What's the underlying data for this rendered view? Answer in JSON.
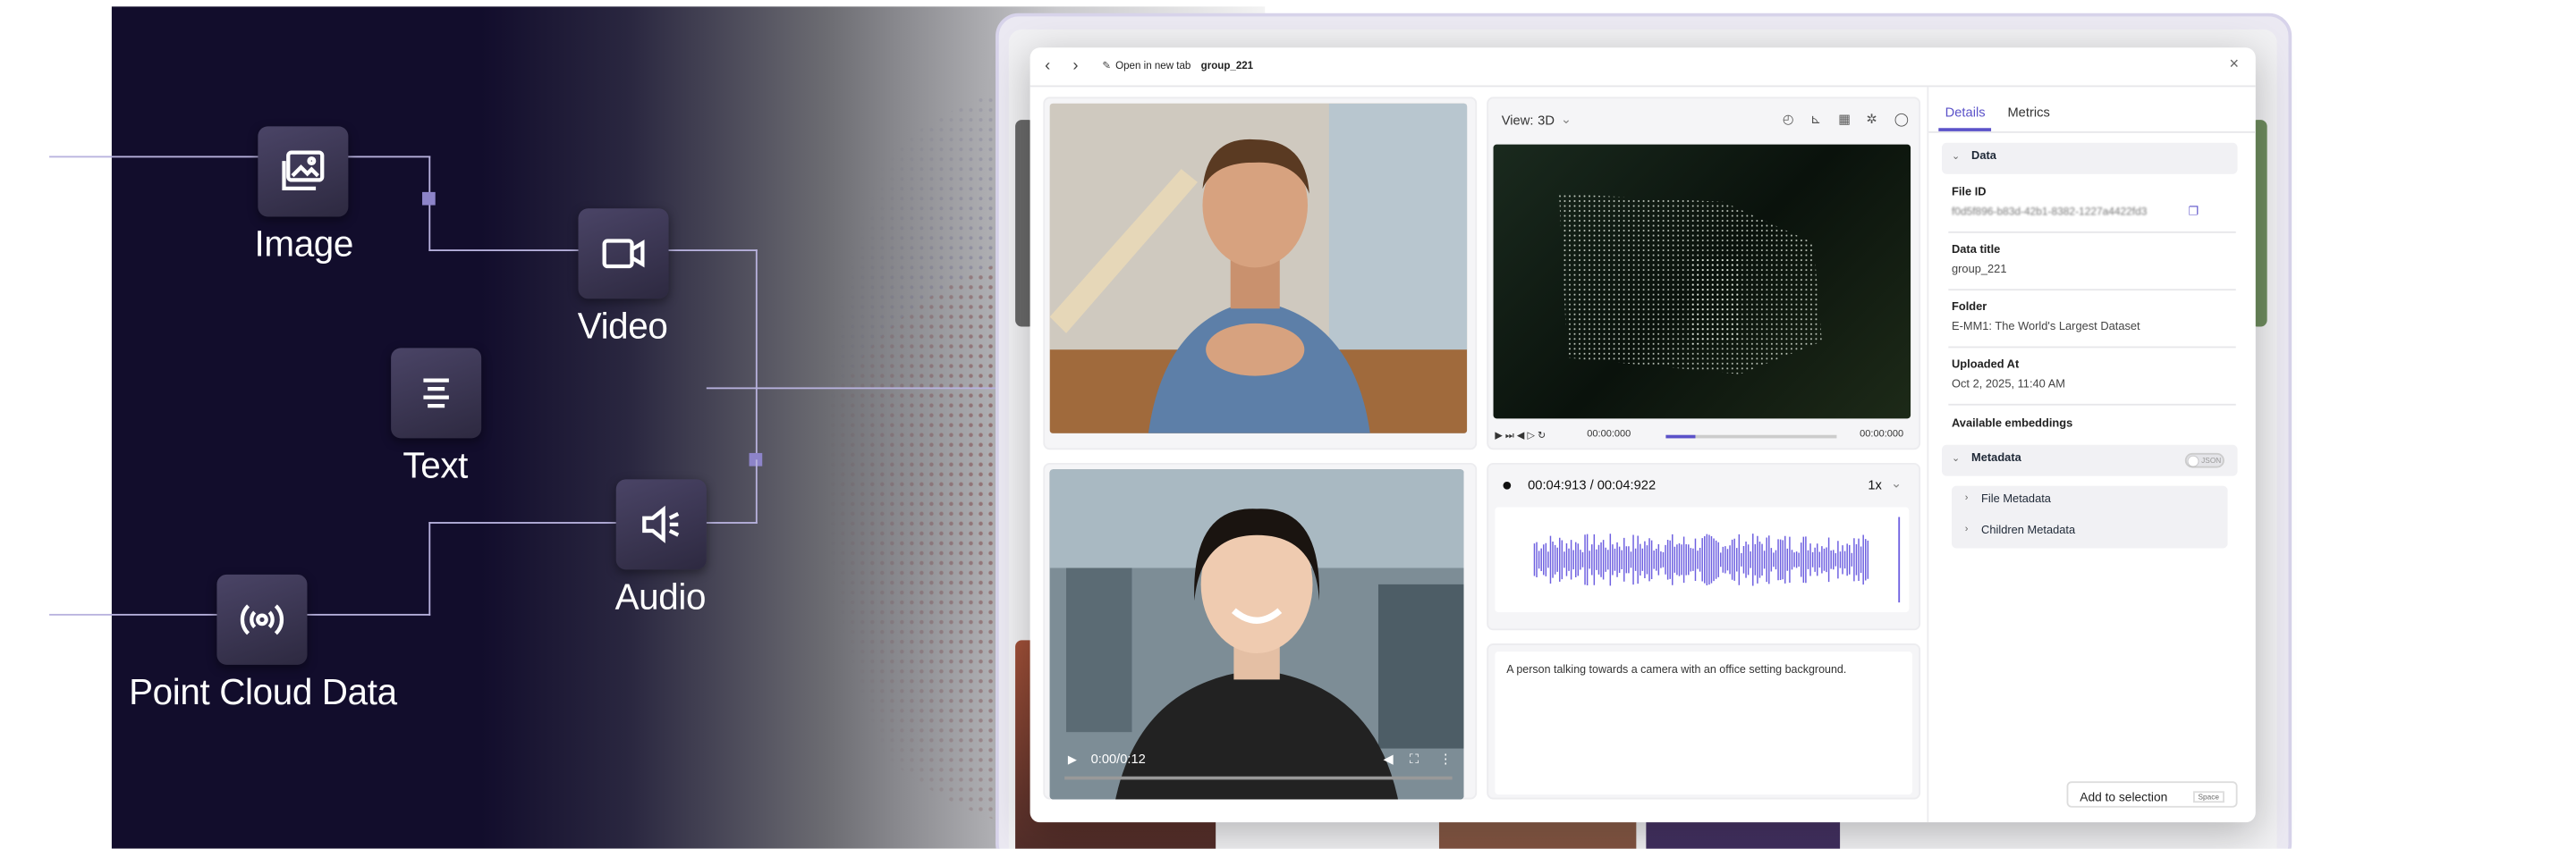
{
  "left_panel": {
    "modalities": [
      {
        "label": "Image",
        "icon": "image-icon"
      },
      {
        "label": "Video",
        "icon": "video-icon"
      },
      {
        "label": "Text",
        "icon": "text-icon"
      },
      {
        "label": "Audio",
        "icon": "audio-icon"
      },
      {
        "label": "Point Cloud Data",
        "icon": "broadcast-icon"
      }
    ]
  },
  "toolbar": {
    "open_new_tab": "Open in new tab",
    "item_name": "group_221"
  },
  "viewer": {
    "view_label": "View:",
    "view_value": "3D",
    "pc_time_current": "00:00:000",
    "pc_time_end": "00:00:000",
    "audio_time": "00:04:913 / 00:04:922",
    "audio_speed": "1x",
    "video_time": "0:00/0:12",
    "caption": "A person talking towards a camera with an office setting background."
  },
  "details": {
    "tabs": [
      "Details",
      "Metrics"
    ],
    "active_tab": "Details",
    "section_data": "Data",
    "file_id_label": "File ID",
    "file_id_value": "f0d5f896-b83d-42b1-8382-1227a4422fd3",
    "data_title_label": "Data title",
    "data_title_value": "group_221",
    "folder_label": "Folder",
    "folder_value": "E-MM1: The World's Largest Dataset",
    "uploaded_label": "Uploaded At",
    "uploaded_value": "Oct 2, 2025, 11:40 AM",
    "embeddings_label": "Available embeddings",
    "section_metadata": "Metadata",
    "toggle_label": "JSON",
    "file_metadata": "File Metadata",
    "children_metadata": "Children Metadata",
    "add_button": "Add to selection",
    "add_shortcut": "Space"
  },
  "colors": {
    "accent": "#5b52c9",
    "dark_bg": "#120d2c",
    "waveform": "#6d5fe0"
  }
}
